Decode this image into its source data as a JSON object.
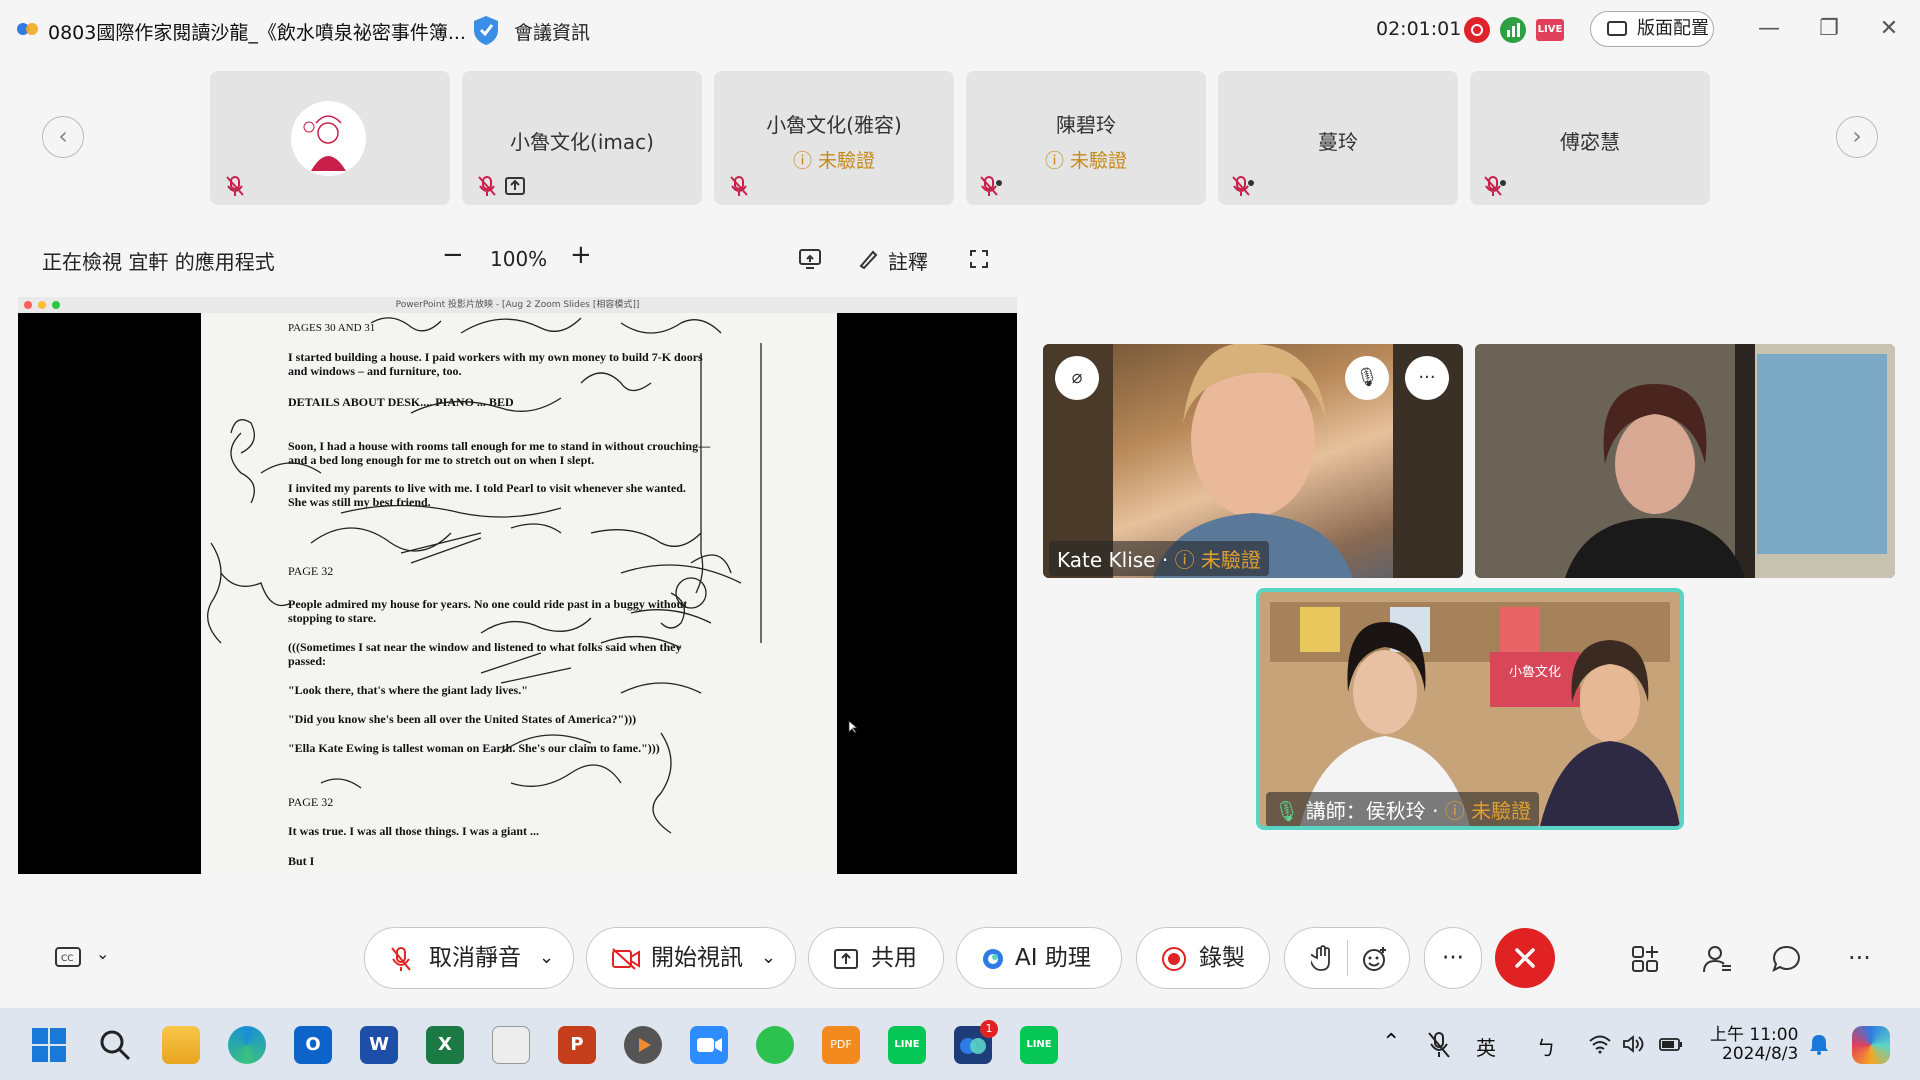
{
  "window": {
    "title": "0803國際作家閱讀沙龍_《飲水噴泉祕密事件簿...",
    "meeting_info": "會議資訊",
    "timer": "02:01:01",
    "live_badge": "LIVE",
    "layout_button": "版面配置"
  },
  "participants": [
    {
      "name": "",
      "status": "",
      "avatar": "illustrated-character"
    },
    {
      "name": "小魯文化(imac)",
      "status": ""
    },
    {
      "name": "小魯文化(雅容)",
      "status": "未驗證"
    },
    {
      "name": "陳碧玲",
      "status": "未驗證"
    },
    {
      "name": "蔓玲",
      "status": ""
    },
    {
      "name": "傅宓慧",
      "status": ""
    }
  ],
  "share_toolbar": {
    "viewing_text": "正在檢視 宜軒 的應用程式",
    "zoom": "100%",
    "annotate": "註釋"
  },
  "shared_document": {
    "window_title": "PowerPoint 投影片放映 - [Aug 2 Zoom Slides [相容模式]]",
    "lines": [
      "PAGES 30 AND 31",
      "I started building a house. I paid workers with my own money to build 7-K doors",
      "and windows – and furniture, too.",
      "DETAILS ABOUT DESK.... PIANO ... BED",
      "Soon, I had a house with rooms tall enough for me to stand in without crouching—",
      "and a bed long enough for me to stretch out on when I slept.",
      "I invited my parents to live with me. I told Pearl to visit whenever she wanted.",
      "She was still my best friend.",
      "PAGE 32",
      "People admired my house for years. No one could ride past in a buggy without",
      "stopping to stare.",
      "(((Sometimes I sat near the window and listened to what folks said when they",
      "passed:",
      "\"Look there, that's where the giant lady lives.\"",
      "\"Did you know she's been all over the United States of America?\")))",
      "\"Ella Kate Ewing is tallest woman on Earth. She's our claim to fame.\")))",
      "PAGE 32",
      "It was true. I was all those things. I was a giant ...",
      "But I"
    ]
  },
  "videos": [
    {
      "name": "Kate Klise",
      "status": "未驗證"
    },
    {
      "name": "",
      "status": ""
    },
    {
      "name": "講師：侯秋玲",
      "status": "未驗證",
      "sign_text": "小魯文化"
    }
  ],
  "toolbar": {
    "unmute": "取消靜音",
    "start_video": "開始視訊",
    "share": "共用",
    "ai": "AI 助理",
    "record": "錄製",
    "more": "···",
    "end_icon": "close-x"
  },
  "taskbar": {
    "ime_lang": "英",
    "ime_mode": "ㄅ",
    "time": "上午 11:00",
    "date": "2024/8/3",
    "badge_count": "1"
  },
  "colors": {
    "accent_red": "#e02222",
    "unverified": "#c48a1e",
    "active_speaker": "#5ad4c4"
  }
}
